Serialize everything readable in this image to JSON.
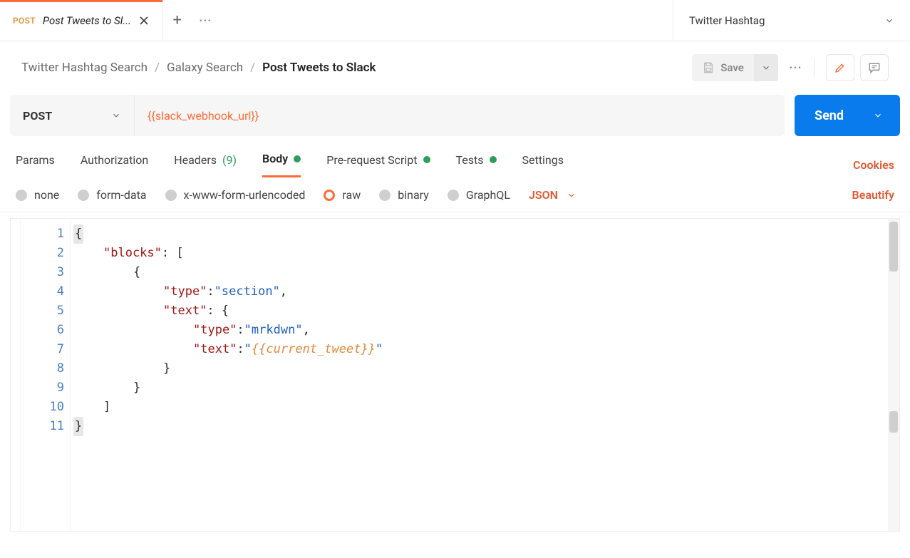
{
  "tabs": {
    "active": {
      "method": "POST",
      "title": "Post Tweets to Sl..."
    }
  },
  "environment": {
    "name": "Twitter Hashtag"
  },
  "breadcrumb": {
    "collection": "Twitter Hashtag Search",
    "folder": "Galaxy Search",
    "request": "Post Tweets to Slack"
  },
  "actions": {
    "save": "Save"
  },
  "request": {
    "method": "POST",
    "url": "{{slack_webhook_url}}",
    "send": "Send"
  },
  "reqTabs": {
    "params": "Params",
    "authorization": "Authorization",
    "headers": "Headers",
    "headersCount": "(9)",
    "body": "Body",
    "prerequest": "Pre-request Script",
    "tests": "Tests",
    "settings": "Settings",
    "cookies": "Cookies"
  },
  "bodyOptions": {
    "none": "none",
    "formdata": "form-data",
    "urlencoded": "x-www-form-urlencoded",
    "raw": "raw",
    "binary": "binary",
    "graphql": "GraphQL",
    "lang": "JSON",
    "beautify": "Beautify"
  },
  "editor": {
    "numbers": [
      "1",
      "2",
      "3",
      "4",
      "5",
      "6",
      "7",
      "8",
      "9",
      "10",
      "11"
    ],
    "l1_brace": "{",
    "l2_key": "\"blocks\"",
    "l2_colon_arr": ": [",
    "l3_openobj": "{",
    "l4_key": "\"type\"",
    "l4_colon": ": ",
    "l4_val": "\"section\"",
    "l4_comma": ",",
    "l5_key": "\"text\"",
    "l5_colon_obj": ": {",
    "l6_key": "\"type\"",
    "l6_colon": ": ",
    "l6_val": "\"mrkdwn\"",
    "l6_comma": ",",
    "l7_key": "\"text\"",
    "l7_colon": ": ",
    "l7_q1": "\"",
    "l7_var": "{{current_tweet}}",
    "l7_q2": "\"",
    "l8_close": "}",
    "l9_close": "}",
    "l10_close": "]",
    "l11_close": "}"
  }
}
